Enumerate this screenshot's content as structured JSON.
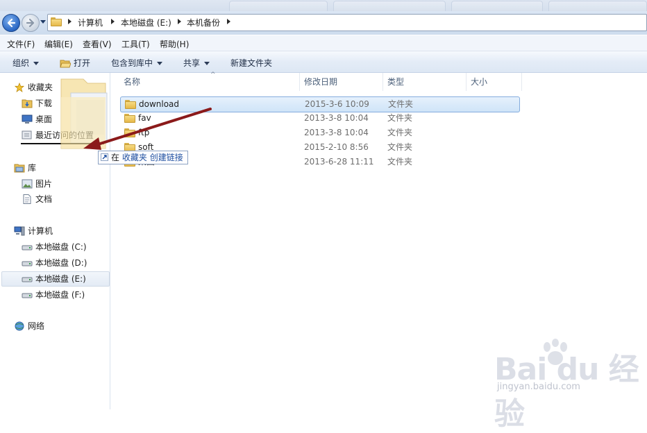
{
  "address_bar": {
    "breadcrumbs": [
      "计算机",
      "本地磁盘 (E:)",
      "本机备份"
    ]
  },
  "menu": {
    "items": [
      "文件(F)",
      "编辑(E)",
      "查看(V)",
      "工具(T)",
      "帮助(H)"
    ]
  },
  "toolbar": {
    "organize": "组织",
    "open": "打开",
    "include_in_library": "包含到库中",
    "share": "共享",
    "new_folder": "新建文件夹"
  },
  "nav": {
    "favorites": "收藏夹",
    "downloads": "下载",
    "desktop": "桌面",
    "recent": "最近访问的位置",
    "libraries": "库",
    "pictures": "图片",
    "documents": "文档",
    "computer": "计算机",
    "drive_c": "本地磁盘 (C:)",
    "drive_d": "本地磁盘 (D:)",
    "drive_e": "本地磁盘 (E:)",
    "drive_f": "本地磁盘 (F:)",
    "network": "网络"
  },
  "columns": {
    "name": "名称",
    "modified": "修改日期",
    "type": "类型",
    "size": "大小"
  },
  "files": [
    {
      "name": "download",
      "date": "2015-3-6  10:09",
      "type": "文件夹"
    },
    {
      "name": "fav",
      "date": "2013-3-8  10:04",
      "type": "文件夹"
    },
    {
      "name": "ftp",
      "date": "2013-3-8  10:04",
      "type": "文件夹"
    },
    {
      "name": "soft",
      "date": "2015-2-10  8:56",
      "type": "文件夹"
    },
    {
      "name": "桌面",
      "date": "2013-6-28  11:11",
      "type": "文件夹"
    }
  ],
  "drag_tooltip": {
    "prefix": "在",
    "target": "收藏夹",
    "action": "创建链接"
  },
  "watermark": {
    "main": "Bai du 经验",
    "sub": "jingyan.baidu.com"
  },
  "colors": {
    "accent": "#2a67c4",
    "selection": "#cfe4f8",
    "arrow": "#8b1a1a"
  }
}
